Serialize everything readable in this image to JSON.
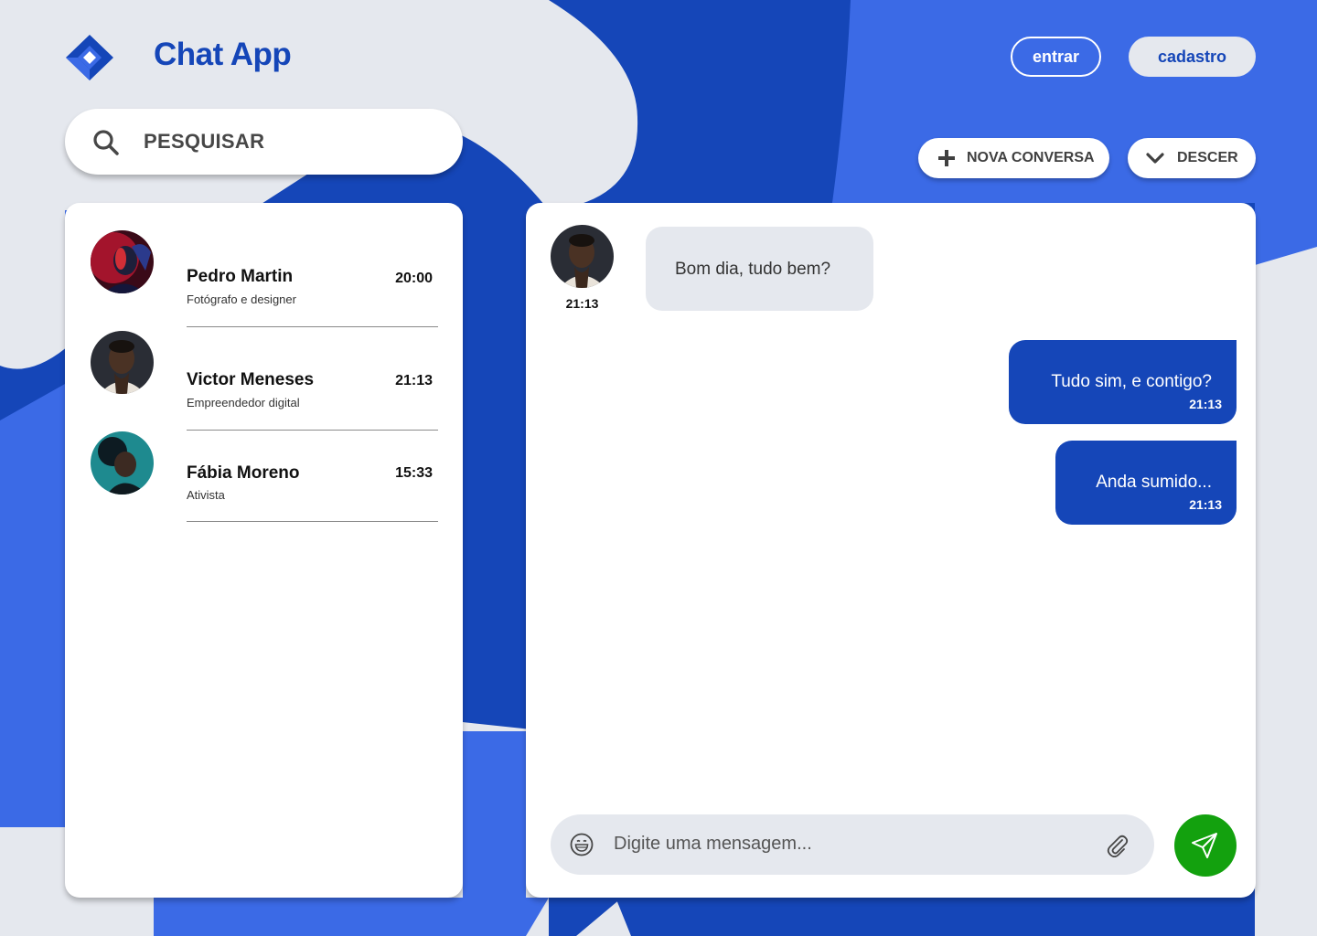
{
  "header": {
    "app_title": "Chat App",
    "login_label": "entrar",
    "signup_label": "cadastro"
  },
  "search": {
    "placeholder": "PESQUISAR"
  },
  "actions": {
    "new_chat_label": "NOVA CONVERSA",
    "scroll_down_label": "DESCER"
  },
  "contacts": [
    {
      "name": "Pedro Martin",
      "role": "Fotógrafo e designer",
      "time": "20:00"
    },
    {
      "name": "Victor Meneses",
      "role": "Empreendedor digital",
      "time": "21:13"
    },
    {
      "name": "Fábia Moreno",
      "role": "Ativista",
      "time": "15:33"
    }
  ],
  "chat": {
    "incoming": {
      "text": "Bom dia, tudo bem?",
      "time": "21:13"
    },
    "outgoing": [
      {
        "text": "Tudo sim, e contigo?",
        "time": "21:13"
      },
      {
        "text": "Anda sumido...",
        "time": "21:13"
      }
    ],
    "input_placeholder": "Digite uma mensagem..."
  },
  "colors": {
    "brand_blue": "#1546b8",
    "bright_blue": "#3b6ae6",
    "background": "#e5e8ee",
    "send_green": "#13a10e"
  },
  "icons": [
    "logo-icon",
    "search-icon",
    "plus-icon",
    "chevron-down-icon",
    "emoji-icon",
    "paperclip-icon",
    "send-icon"
  ]
}
